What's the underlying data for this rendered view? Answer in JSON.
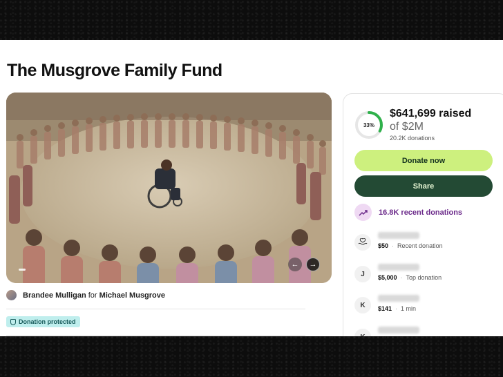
{
  "campaign": {
    "title": "The Musgrove Family Fund",
    "organizer_name": "Brandee Mulligan",
    "organizer_connector": "for",
    "beneficiary_name": "Michael Musgrove",
    "protected_label": "Donation protected"
  },
  "hero": {
    "slide_index": 1,
    "prev_icon": "arrow-left-icon",
    "next_icon": "arrow-right-icon"
  },
  "progress": {
    "percent": 33,
    "percent_label": "33%",
    "raised": "$641,699 raised",
    "goal": "of $2M",
    "donation_count": "20.2K donations",
    "accent": "#2fb14b"
  },
  "actions": {
    "donate_label": "Donate now",
    "share_label": "Share"
  },
  "recent": {
    "label": "16.8K recent donations",
    "icon": "trending-up-icon"
  },
  "donations": [
    {
      "avatar": "",
      "avatar_icon": "heart-hand-icon",
      "amount": "$50",
      "note": "Recent donation"
    },
    {
      "avatar": "J",
      "amount": "$5,000",
      "note": "Top donation"
    },
    {
      "avatar": "K",
      "amount": "$141",
      "note": "1 min"
    },
    {
      "avatar": "K",
      "amount": "",
      "note": ""
    }
  ],
  "colors": {
    "donate_bg": "#cdf07e",
    "share_bg": "#234a34",
    "recent_text": "#6b2a8a",
    "protected_bg": "#bfeeed"
  }
}
